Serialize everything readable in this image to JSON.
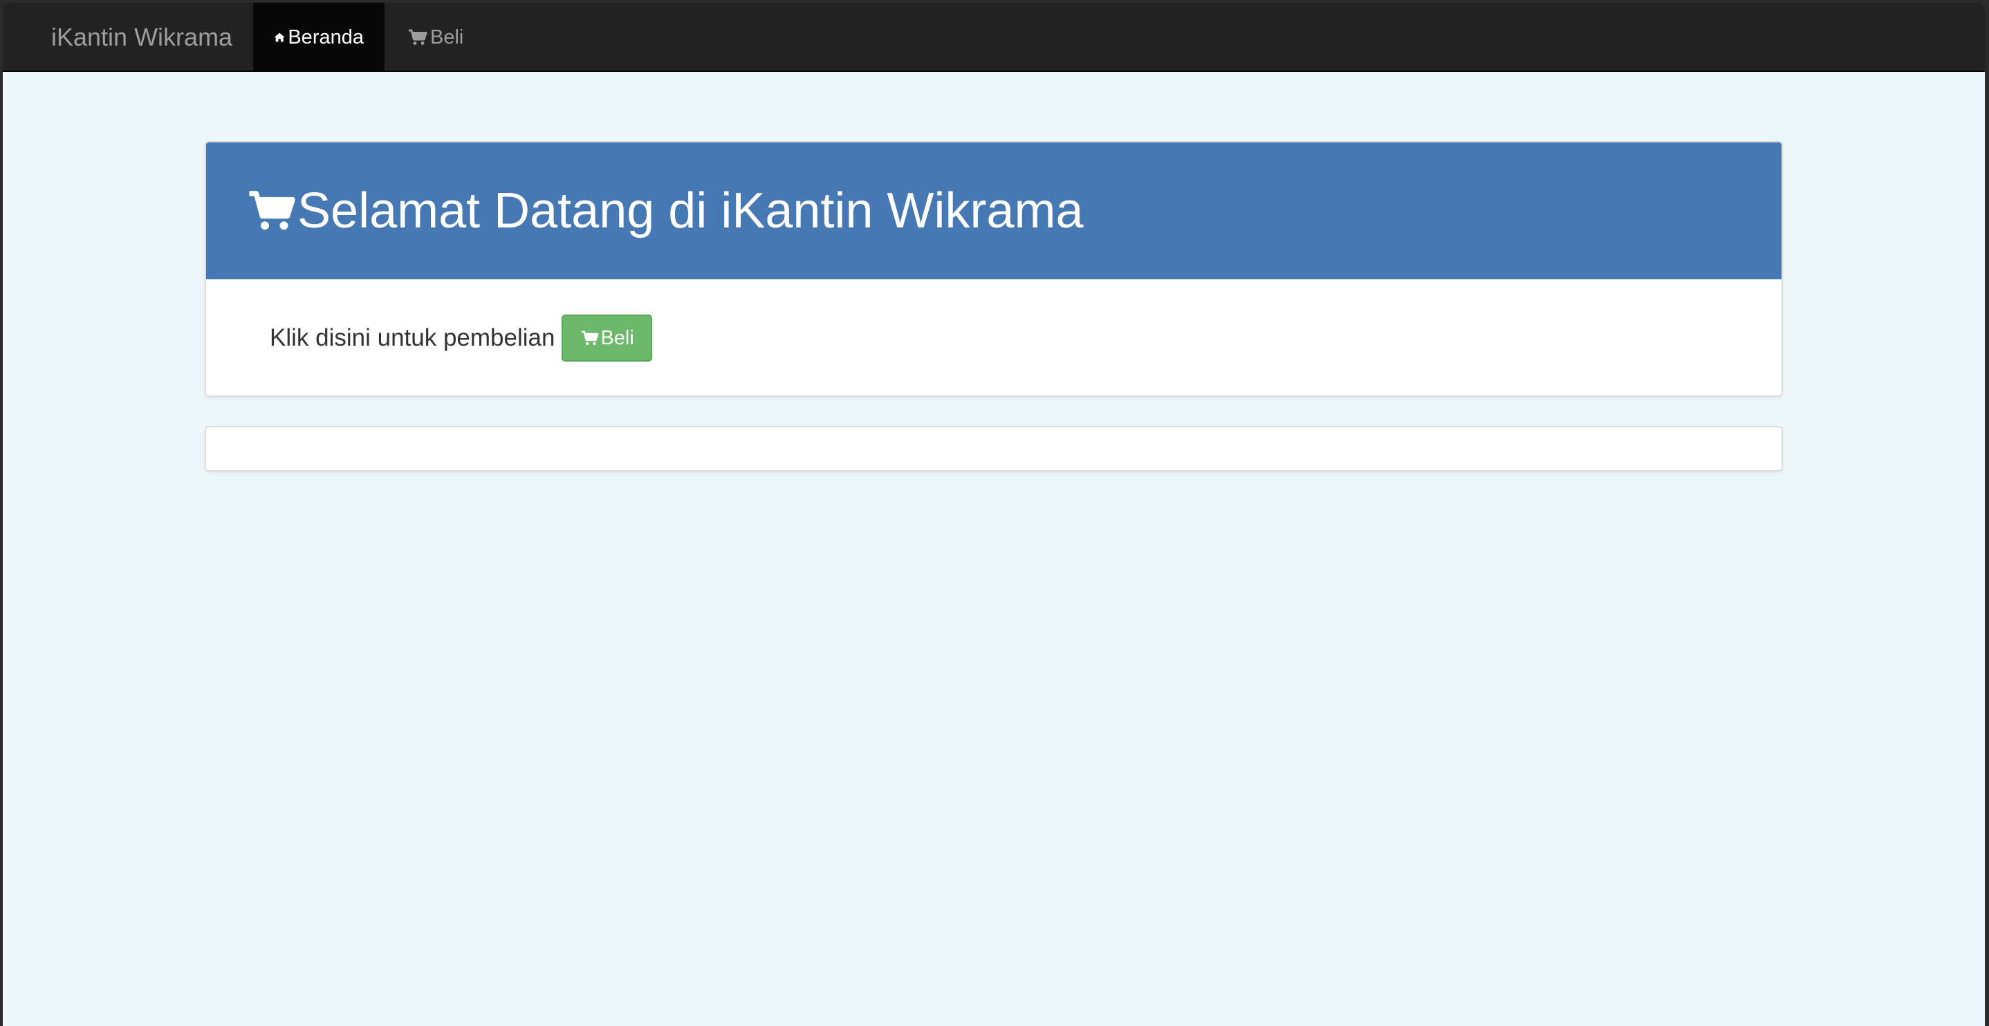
{
  "navbar": {
    "brand": "iKantin Wikrama",
    "items": [
      {
        "label": "Beranda",
        "icon": "home-icon",
        "active": true
      },
      {
        "label": " Beli",
        "icon": "cart-icon",
        "active": false
      }
    ]
  },
  "hero": {
    "title": "Selamat Datang di iKantin Wikrama",
    "title_icon": "cart-icon",
    "body_text": "Klik disini untuk pembelian",
    "button_label": "Beli",
    "button_icon": "cart-icon"
  },
  "colors": {
    "navbar_bg": "#222222",
    "nav_active_bg": "#080808",
    "page_bg": "#ecf5f8",
    "hero_heading_bg": "#4679b3",
    "button_bg": "#6db96c"
  }
}
